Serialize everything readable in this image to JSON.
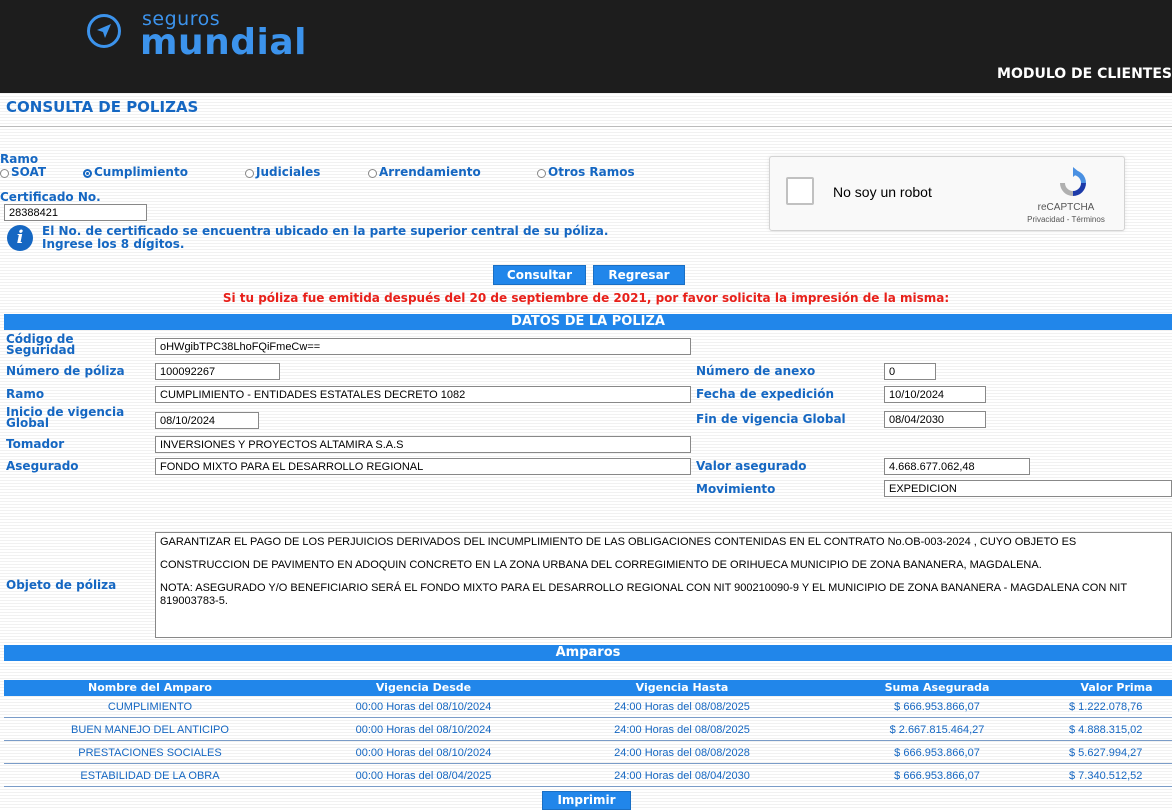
{
  "header": {
    "brand_small": "seguros",
    "brand_big": "mundial",
    "module_title": "MODULO DE CLIENTES"
  },
  "page_title": "CONSULTA DE POLIZAS",
  "search": {
    "ramo_label": "Ramo",
    "options": [
      "SOAT",
      "Cumplimiento",
      "Judiciales",
      "Arrendamiento",
      "Otros Ramos"
    ],
    "selected": "Cumplimiento",
    "certificado_label": "Certificado No.",
    "certificado_value": "28388421",
    "info_text": "El No. de certificado se encuentra ubicado en la parte superior central de su póliza. Ingrese los 8 dígitos."
  },
  "captcha": {
    "label": "No soy un robot",
    "brand": "reCAPTCHA",
    "links": "Privacidad - Términos"
  },
  "buttons": {
    "consultar": "Consultar",
    "regresar": "Regresar",
    "imprimir": "Imprimir"
  },
  "notice": "Si tu póliza fue emitida después del 20 de septiembre de 2021, por favor solicita la impresión de la misma:",
  "poliza": {
    "section_title": "DATOS DE LA POLIZA",
    "codigo_label": "Código de Seguridad",
    "codigo_value": "oHWgibTPC38LhoFQiFmeCw==",
    "numero_label": "Número de póliza",
    "numero_value": "100092267",
    "anexo_label": "Número de anexo",
    "anexo_value": "0",
    "ramo_label": "Ramo",
    "ramo_value": "CUMPLIMIENTO - ENTIDADES ESTATALES DECRETO 1082",
    "fecha_exp_label": "Fecha de expedición",
    "fecha_exp_value": "10/10/2024",
    "inicio_label": "Inicio de vigencia Global",
    "inicio_value": "08/10/2024",
    "fin_label": "Fin de vigencia Global",
    "fin_value": "08/04/2030",
    "tomador_label": "Tomador",
    "tomador_value": "INVERSIONES Y PROYECTOS ALTAMIRA S.A.S",
    "asegurado_label": "Asegurado",
    "asegurado_value": "FONDO MIXTO PARA EL DESARROLLO REGIONAL",
    "valor_label": "Valor asegurado",
    "valor_value": "4.668.677.062,48",
    "movimiento_label": "Movimiento",
    "movimiento_value": "EXPEDICION",
    "objeto_label": "Objeto de póliza",
    "objeto_lines": [
      "GARANTIZAR EL PAGO DE LOS PERJUICIOS DERIVADOS DEL INCUMPLIMIENTO DE LAS OBLIGACIONES CONTENIDAS EN EL CONTRATO No.OB-003-2024 , CUYO OBJETO ES",
      "CONSTRUCCION DE PAVIMENTO EN ADOQUIN CONCRETO EN LA ZONA URBANA DEL CORREGIMIENTO DE ORIHUECA MUNICIPIO DE ZONA BANANERA, MAGDALENA.",
      "NOTA: ASEGURADO Y/O BENEFICIARIO SERÁ EL FONDO MIXTO PARA EL DESARROLLO REGIONAL CON NIT 900210090-9 Y EL MUNICIPIO DE ZONA BANANERA - MAGDALENA CON NIT  819003783-5."
    ]
  },
  "amparos": {
    "title": "Amparos",
    "columns": [
      "Nombre del Amparo",
      "Vigencia Desde",
      "Vigencia Hasta",
      "Suma Asegurada",
      "Valor Prima"
    ],
    "rows": [
      [
        "CUMPLIMIENTO",
        "00:00 Horas del 08/10/2024",
        "24:00 Horas del 08/08/2025",
        "$ 666.953.866,07",
        "$ 1.222.078,76"
      ],
      [
        "BUEN MANEJO DEL ANTICIPO",
        "00:00 Horas del 08/10/2024",
        "24:00 Horas del 08/08/2025",
        "$ 2.667.815.464,27",
        "$ 4.888.315,02"
      ],
      [
        "PRESTACIONES SOCIALES",
        "00:00 Horas del 08/10/2024",
        "24:00 Horas del 08/08/2028",
        "$ 666.953.866,07",
        "$ 5.627.994,27"
      ],
      [
        "ESTABILIDAD DE LA OBRA",
        "00:00 Horas del 08/04/2025",
        "24:00 Horas del 08/04/2030",
        "$ 666.953.866,07",
        "$ 7.340.512,52"
      ]
    ]
  },
  "colors": {
    "brand_blue": "#3c93ec",
    "label_blue": "#1567c2",
    "bar_blue": "#2186ea",
    "notice_red": "#e8201a",
    "header_bg": "#1d1d1d"
  }
}
